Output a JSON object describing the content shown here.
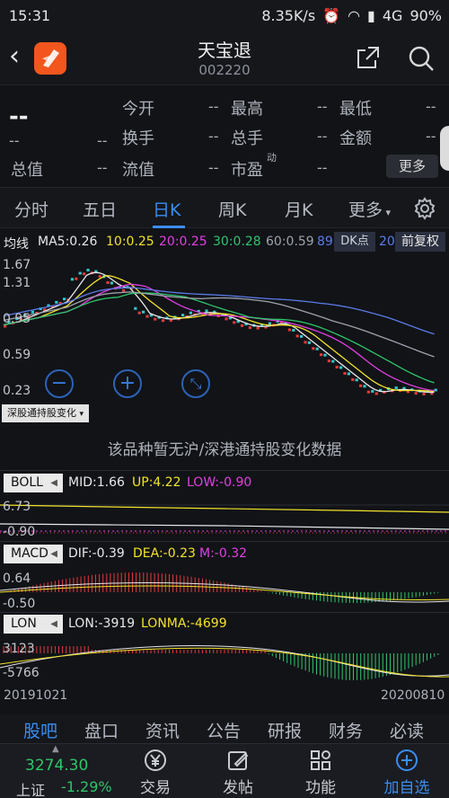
{
  "status": {
    "time": "15:31",
    "net": "8.35K/s",
    "signal": "4G",
    "battery": "90%"
  },
  "header": {
    "name": "天宝退",
    "code": "002220"
  },
  "quote": {
    "price": "--",
    "change": "--",
    "change_pct": "--",
    "fields": [
      {
        "label": "今开",
        "value": "--"
      },
      {
        "label": "最高",
        "value": "--"
      },
      {
        "label": "最低",
        "value": "--"
      },
      {
        "label": "换手",
        "value": "--"
      },
      {
        "label": "总手",
        "value": "--"
      },
      {
        "label": "金额",
        "value": "--"
      },
      {
        "label": "总值",
        "value": "--"
      },
      {
        "label": "流值",
        "value": "--"
      },
      {
        "label": "市盈",
        "sup": "动",
        "value": "--"
      }
    ],
    "more": "更多"
  },
  "tabs": [
    "分时",
    "五日",
    "日K",
    "周K",
    "月K",
    "更多"
  ],
  "active_tab": "日K",
  "ma": {
    "label": "均线",
    "items": [
      {
        "text": "MA5:0.26",
        "color": "#e8e8e8"
      },
      {
        "text": "10:0.25",
        "color": "#f3e22a"
      },
      {
        "text": "20:0.25",
        "color": "#e040e0"
      },
      {
        "text": "30:0.28",
        "color": "#2fc56a"
      },
      {
        "text": "60:0.59",
        "color": "#9ea3ab"
      },
      {
        "text": "89",
        "color": "#5b7be8"
      },
      {
        "text": "20",
        "color": "#5b7be8"
      }
    ],
    "dk": "DK点",
    "fq": "前复权"
  },
  "kline": {
    "y_ticks": [
      "1.67",
      "1.31",
      "0.95",
      "0.59",
      "0.23"
    ]
  },
  "hk_tag": "深股通持股变化",
  "hk_nodata": "该品种暂无沪/深港通持股变化数据",
  "boll": {
    "name": "BOLL",
    "mid": "MID:1.66",
    "up": "UP:4.22",
    "low": "LOW:-0.90",
    "y_top": "6.73",
    "y_bot": "-0.90"
  },
  "macd": {
    "name": "MACD",
    "dif": "DIF:-0.39",
    "dea": "DEA:-0.23",
    "m": "M:-0.32",
    "y_top": "0.64",
    "y_bot": "-0.50"
  },
  "lon": {
    "name": "LON",
    "lon": "LON:-3919",
    "lonma": "LONMA:-4699",
    "y_top": "3123",
    "y_bot": "-5766"
  },
  "dates": {
    "start": "20191021",
    "end": "20200810"
  },
  "subtabs": [
    "股吧",
    "盘口",
    "资讯",
    "公告",
    "研报",
    "财务",
    "必读"
  ],
  "active_subtab": "股吧",
  "index": {
    "value": "3274.30",
    "name": "上证",
    "pct": "-1.29%"
  },
  "nav": [
    "交易",
    "发帖",
    "功能",
    "加自选"
  ],
  "colors": {
    "accent": "#3a8ef0",
    "up": "#e23b3b",
    "down": "#2fc56a",
    "background": "#111317"
  }
}
